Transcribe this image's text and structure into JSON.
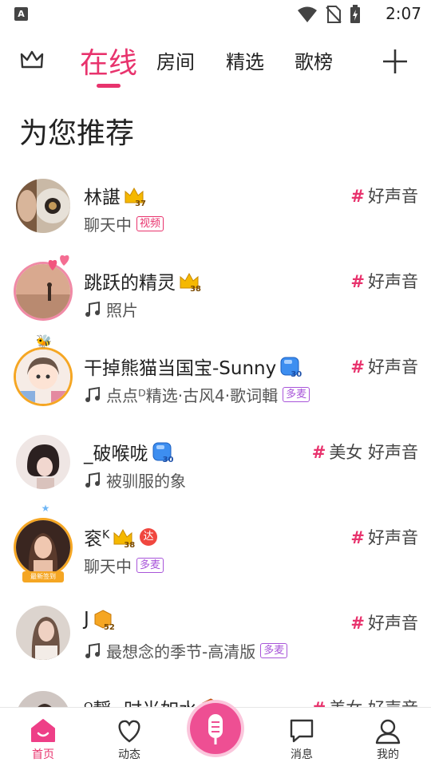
{
  "status_bar": {
    "app_icon_letter": "A",
    "time": "2:07"
  },
  "top_nav": {
    "tabs": [
      {
        "label": "在线",
        "active": true
      },
      {
        "label": "房间",
        "active": false
      },
      {
        "label": "精选",
        "active": false
      },
      {
        "label": "歌榜",
        "active": false
      }
    ],
    "accent_color": "#e8336d"
  },
  "section_title": "为您推荐",
  "rooms": [
    {
      "name": "林諶",
      "level": "37",
      "level_kind": "crown",
      "sub_text": "聊天中",
      "sub_music": false,
      "badge": "视频",
      "badge_color": "pink",
      "tag": "好声音",
      "tag_prefix": ""
    },
    {
      "name": "跳跃的精灵",
      "level": "38",
      "level_kind": "crown",
      "sub_text": "照片",
      "sub_music": true,
      "badge": "",
      "tag": "好声音",
      "tag_prefix": ""
    },
    {
      "name": "干掉熊猫当国宝-Sunny",
      "level": "30",
      "level_kind": "gem",
      "sub_text": "点点ᴰ精选·古风4·歌词輯",
      "sub_music": true,
      "badge": "多麦",
      "badge_color": "purple",
      "tag": "好声音",
      "tag_prefix": ""
    },
    {
      "name": "_破喉咙",
      "level": "30",
      "level_kind": "gem",
      "sub_text": "被驯服的象",
      "sub_music": true,
      "badge": "",
      "tag": "好声音",
      "tag_prefix": "美女"
    },
    {
      "name": "衮",
      "name_sup": "K",
      "level": "38",
      "level_kind": "crown",
      "extra_badge": "达",
      "sub_text": "聊天中",
      "sub_music": false,
      "badge": "多麦",
      "badge_color": "purple",
      "tag": "好声音",
      "tag_prefix": "",
      "frame_label": "最新签到"
    },
    {
      "name": "J",
      "level": "52",
      "level_kind": "hex",
      "sub_text": "最想念的季节-高清版",
      "sub_music": true,
      "badge": "多麦",
      "badge_color": "purple",
      "tag": "好声音",
      "tag_prefix": ""
    },
    {
      "name": "ᴼ靜 -时光如水",
      "level": "",
      "level_kind": "hex",
      "sub_text": "",
      "sub_music": false,
      "badge": "",
      "tag": "好声音",
      "tag_prefix": "美女"
    }
  ],
  "bottom_nav": [
    {
      "label": "首页",
      "icon": "home-icon",
      "active": true
    },
    {
      "label": "动态",
      "icon": "heart-icon",
      "active": false
    },
    {
      "label": "",
      "icon": "mic-icon",
      "active": false
    },
    {
      "label": "消息",
      "icon": "message-icon",
      "active": false
    },
    {
      "label": "我的",
      "icon": "profile-icon",
      "active": false
    }
  ]
}
